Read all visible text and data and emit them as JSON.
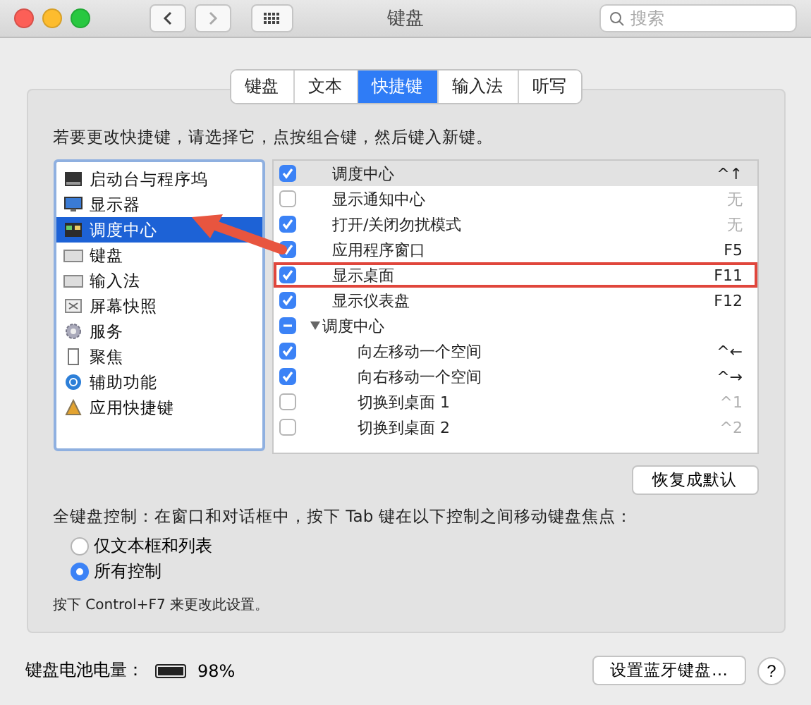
{
  "window": {
    "title": "键盘",
    "search_placeholder": "搜索"
  },
  "tabs": [
    {
      "label": "键盘",
      "selected": false
    },
    {
      "label": "文本",
      "selected": false
    },
    {
      "label": "快捷键",
      "selected": true
    },
    {
      "label": "输入法",
      "selected": false
    },
    {
      "label": "听写",
      "selected": false
    }
  ],
  "instruction": "若要更改快捷键，请选择它，点按组合键，然后键入新键。",
  "categories": [
    {
      "label": "启动台与程序坞",
      "kind": "dock",
      "selected": false
    },
    {
      "label": "显示器",
      "kind": "display",
      "selected": false
    },
    {
      "label": "调度中心",
      "kind": "mission",
      "selected": true
    },
    {
      "label": "键盘",
      "kind": "keyboard",
      "selected": false
    },
    {
      "label": "输入法",
      "kind": "keyboard",
      "selected": false
    },
    {
      "label": "屏幕快照",
      "kind": "screenshot",
      "selected": false
    },
    {
      "label": "服务",
      "kind": "gear",
      "selected": false
    },
    {
      "label": "聚焦",
      "kind": "doc",
      "selected": false
    },
    {
      "label": "辅助功能",
      "kind": "access",
      "selected": false
    },
    {
      "label": "应用快捷键",
      "kind": "app",
      "selected": false
    }
  ],
  "shortcuts": [
    {
      "label": "调度中心",
      "checked": true,
      "shortcut": "^↑",
      "shortcut_dimmed": false,
      "selected": true,
      "highlighted": false
    },
    {
      "label": "显示通知中心",
      "checked": false,
      "shortcut": "无",
      "shortcut_dimmed": true,
      "selected": false,
      "highlighted": false
    },
    {
      "label": "打开/关闭勿扰模式",
      "checked": true,
      "shortcut": "无",
      "shortcut_dimmed": true,
      "selected": false,
      "highlighted": false
    },
    {
      "label": "应用程序窗口",
      "checked": true,
      "shortcut": "F5",
      "shortcut_dimmed": false,
      "selected": false,
      "highlighted": false
    },
    {
      "label": "显示桌面",
      "checked": true,
      "shortcut": "F11",
      "shortcut_dimmed": false,
      "selected": false,
      "highlighted": true
    },
    {
      "label": "显示仪表盘",
      "checked": true,
      "shortcut": "F12",
      "shortcut_dimmed": false,
      "selected": false,
      "highlighted": false
    },
    {
      "label": "调度中心",
      "checked": true,
      "partial": true,
      "expanded": true,
      "selected": false,
      "highlighted": false,
      "children": [
        {
          "label": "向左移动一个空间",
          "checked": true,
          "shortcut": "^←",
          "shortcut_dimmed": false,
          "selected": false,
          "highlighted": false
        },
        {
          "label": "向右移动一个空间",
          "checked": true,
          "shortcut": "^→",
          "shortcut_dimmed": false,
          "selected": false,
          "highlighted": false
        },
        {
          "label": "切换到桌面 1",
          "checked": false,
          "shortcut": "^1",
          "shortcut_dimmed": true,
          "selected": false,
          "highlighted": false
        },
        {
          "label": "切换到桌面 2",
          "checked": false,
          "shortcut": "^2",
          "shortcut_dimmed": true,
          "selected": false,
          "highlighted": false
        }
      ]
    }
  ],
  "restore_button": "恢复成默认",
  "full_keyboard_access": {
    "label": "全键盘控制：在窗口和对话框中，按下 Tab 键在以下控制之间移动键盘焦点：",
    "options": [
      {
        "label": "仅文本框和列表",
        "selected": false
      },
      {
        "label": "所有控制",
        "selected": true
      }
    ],
    "hint": "按下 Control+F7 来更改此设置。"
  },
  "battery": {
    "label": "键盘电池电量：",
    "level": 0.98,
    "reading": "98%"
  },
  "bluetooth_button": "设置蓝牙键盘…",
  "help_button": "?"
}
